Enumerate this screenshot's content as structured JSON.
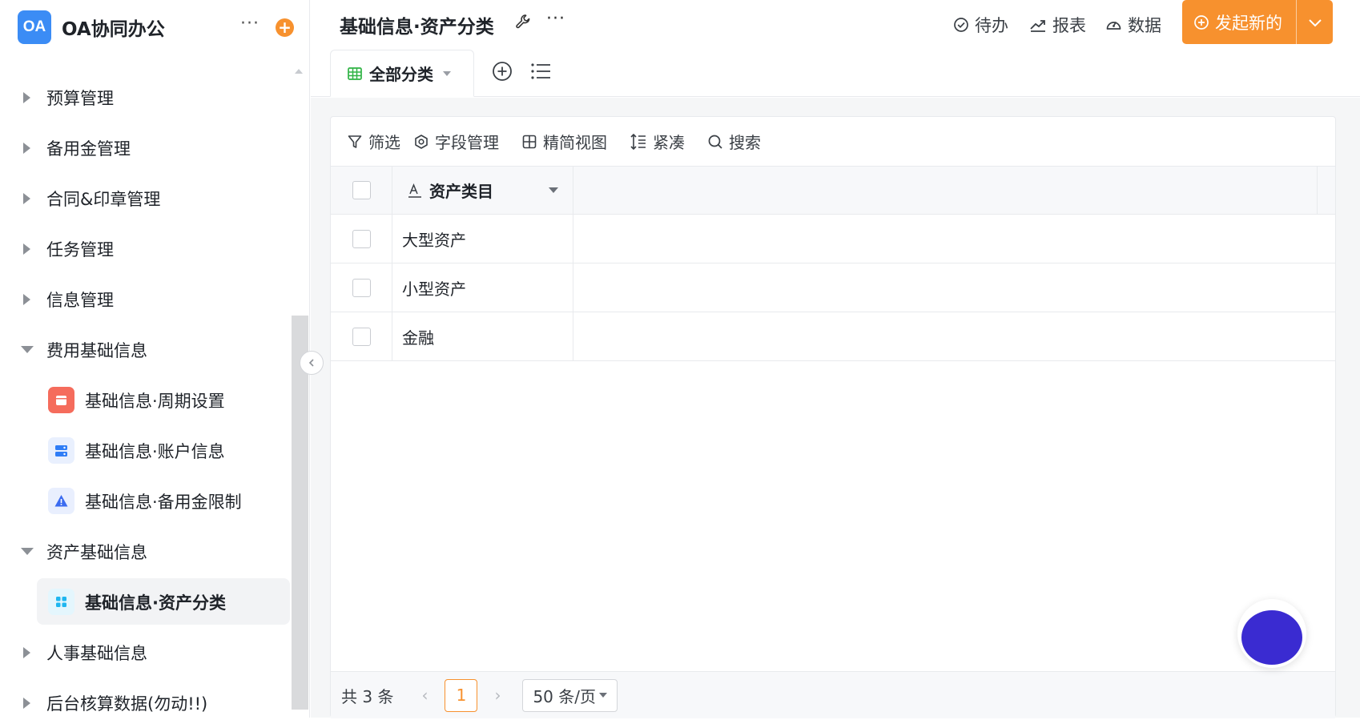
{
  "sidebar": {
    "logo_text": "OA",
    "app_name": "OA协同办公",
    "more_label": "···",
    "add_label": "+",
    "groups": [
      {
        "label": "预算管理",
        "expanded": false
      },
      {
        "label": "备用金管理",
        "expanded": false
      },
      {
        "label": "合同&印章管理",
        "expanded": false
      },
      {
        "label": "任务管理",
        "expanded": false
      },
      {
        "label": "信息管理",
        "expanded": false
      },
      {
        "label": "费用基础信息",
        "expanded": true
      },
      {
        "label": "资产基础信息",
        "expanded": true
      },
      {
        "label": "人事基础信息",
        "expanded": false
      },
      {
        "label": "后台核算数据(勿动!!)",
        "expanded": false
      }
    ],
    "sub_items": [
      {
        "label": "基础信息·周期设置",
        "icon": "calendar-icon",
        "color": "#f56c5c"
      },
      {
        "label": "基础信息·账户信息",
        "icon": "server-icon",
        "color": "#2f7df6"
      },
      {
        "label": "基础信息·备用金限制",
        "icon": "warning-icon",
        "color": "#3b6bf0"
      },
      {
        "label": "基础信息·资产分类",
        "icon": "apps-icon",
        "color": "#1fb6f0",
        "active": true
      }
    ]
  },
  "header": {
    "title": "基础信息·资产分类",
    "more_label": "···",
    "todo_label": "待办",
    "report_label": "报表",
    "data_label": "数据",
    "launch_label": "发起新的",
    "accent": "#f7912e"
  },
  "tabs": {
    "view_label": "全部分类"
  },
  "toolbar": {
    "filter": "筛选",
    "fields": "字段管理",
    "compact_view": "精简视图",
    "density": "紧凑",
    "search": "搜索"
  },
  "table": {
    "column": "资产类目",
    "rows": [
      "大型资产",
      "小型资产",
      "金融"
    ]
  },
  "pagination": {
    "total": "共 3 条",
    "current_page": "1",
    "page_size": "50 条/页",
    "prev": "‹",
    "next": "›"
  }
}
